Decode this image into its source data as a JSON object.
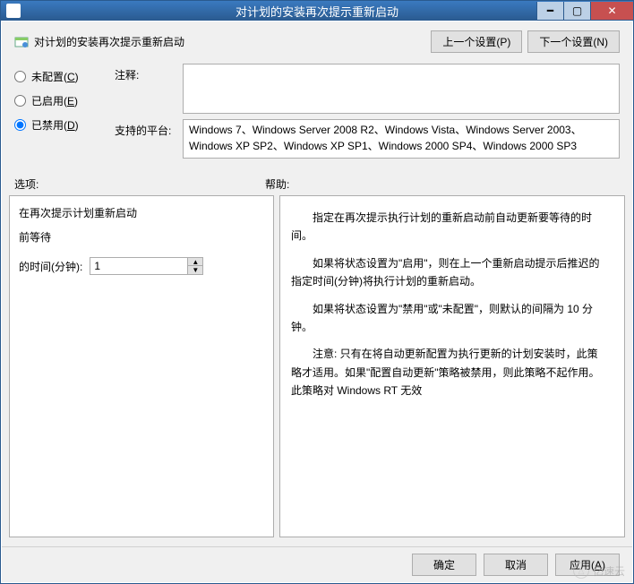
{
  "window": {
    "title": "对计划的安装再次提示重新启动",
    "header_title": "对计划的安装再次提示重新启动"
  },
  "nav": {
    "prev": "上一个设置(P)",
    "next": "下一个设置(N)"
  },
  "radios": {
    "not_configured": "未配置(C)",
    "enabled": "已启用(E)",
    "disabled": "已禁用(D)"
  },
  "fields": {
    "comment_label": "注释:",
    "comment_value": "",
    "platform_label": "支持的平台:",
    "platform_value": "Windows 7、Windows Server 2008 R2、Windows Vista、Windows Server 2003、Windows XP SP2、Windows XP SP1、Windows 2000 SP4、Windows 2000 SP3"
  },
  "section_labels": {
    "options": "选项:",
    "help": "帮助:"
  },
  "options_panel": {
    "line1": "在再次提示计划重新启动",
    "line2": "前等待",
    "spinner_label": "的时间(分钟):",
    "spinner_value": "1"
  },
  "help_panel": {
    "p1": "指定在再次提示执行计划的重新启动前自动更新要等待的时间。",
    "p2": "如果将状态设置为\"启用\"，则在上一个重新启动提示后推迟的指定时间(分钟)将执行计划的重新启动。",
    "p3": "如果将状态设置为\"禁用\"或\"未配置\"，则默认的间隔为 10 分钟。",
    "p4": "注意: 只有在将自动更新配置为执行更新的计划安装时，此策略才适用。如果\"配置自动更新\"策略被禁用，则此策略不起作用。此策略对 Windows RT 无效"
  },
  "footer": {
    "ok": "确定",
    "cancel": "取消",
    "apply": "应用(A)"
  },
  "watermark": "亿速云"
}
